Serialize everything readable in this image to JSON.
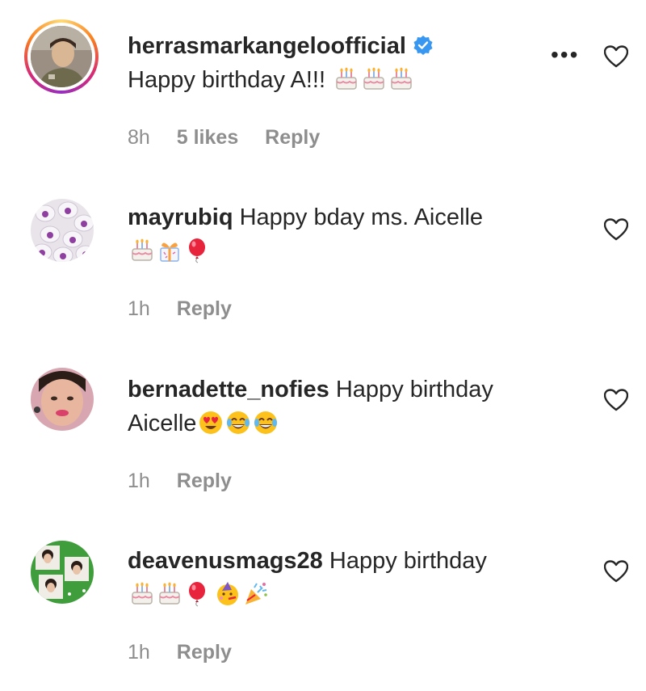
{
  "comments": [
    {
      "username": "herrasmarkangeloofficial",
      "text": "Happy birthday A!!!",
      "emoji_icons": [
        "birthday-cake-icon",
        "birthday-cake-icon",
        "birthday-cake-icon"
      ],
      "verified": true,
      "time": "8h",
      "likes": "5 likes",
      "reply": "Reply"
    },
    {
      "username": "mayrubiq",
      "text": "Happy bday ms. Aicelle",
      "emoji_icons": [
        "birthday-cake-icon",
        "wrapped-gift-icon",
        "balloon-icon"
      ],
      "time": "1h",
      "reply": "Reply"
    },
    {
      "username": "bernadette_nofies",
      "text": "Happy birthday",
      "text_line2": "Aicelle",
      "emoji_icons": [
        "heart-eyes-icon",
        "tears-of-joy-icon",
        "tears-of-joy-icon"
      ],
      "time": "1h",
      "reply": "Reply"
    },
    {
      "username": "deavenusmags28",
      "text": "Happy birthday",
      "emoji_icons": [
        "birthday-cake-icon",
        "birthday-cake-icon",
        "balloon-icon",
        "partying-face-icon",
        "party-popper-icon"
      ],
      "time": "1h",
      "reply": "Reply"
    }
  ],
  "colors": {
    "verified": "#3897f0",
    "meta": "#8e8e8e",
    "text": "#262626"
  }
}
